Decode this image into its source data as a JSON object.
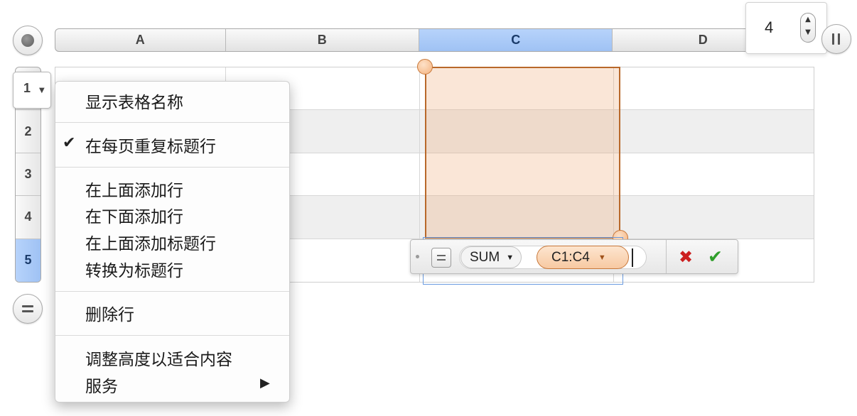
{
  "column_header": {
    "columns": [
      {
        "label": "A",
        "selected": false
      },
      {
        "label": "B",
        "selected": false
      },
      {
        "label": "C",
        "selected": true
      },
      {
        "label": "D",
        "selected": false
      }
    ]
  },
  "column_stepper": {
    "value": "4"
  },
  "row_header": {
    "rows": [
      {
        "label": "1",
        "selected": false
      },
      {
        "label": "2",
        "selected": false
      },
      {
        "label": "3",
        "selected": false
      },
      {
        "label": "4",
        "selected": false
      },
      {
        "label": "5",
        "selected": true
      }
    ],
    "dropdown_row": "1"
  },
  "formula_editor": {
    "function": "SUM",
    "range": "C1:C4"
  },
  "context_menu": {
    "show_table_name": "显示表格名称",
    "repeat_header_rows": "在每页重复标题行",
    "repeat_header_checked": true,
    "add_row_above": "在上面添加行",
    "add_row_below": "在下面添加行",
    "add_header_row_above": "在上面添加标题行",
    "convert_to_header_row": "转换为标题行",
    "delete_row": "删除行",
    "fit_height": "调整高度以适合内容",
    "services": "服务"
  },
  "colors": {
    "selection_blue": "#9fc2f4",
    "range_orange": "#f4b27e",
    "cancel_red": "#cc1f1f",
    "accept_green": "#2f9e2a"
  }
}
